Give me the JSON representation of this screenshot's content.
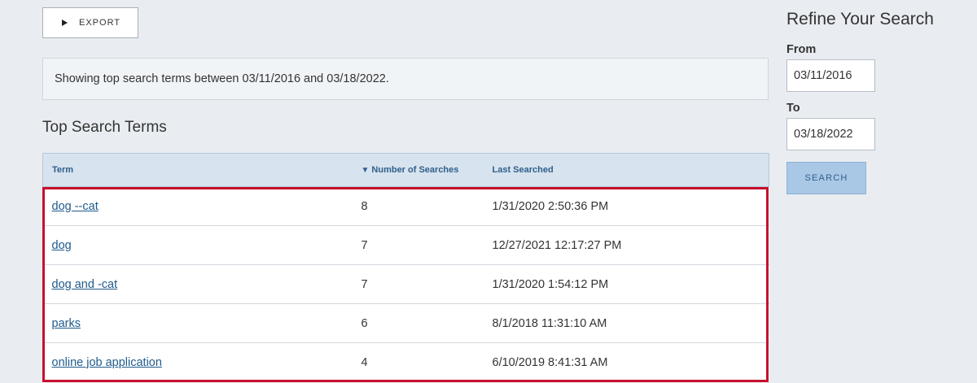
{
  "toolbar": {
    "export_label": "EXPORT"
  },
  "info": {
    "summary": "Showing top search terms between 03/11/2016 and 03/18/2022."
  },
  "results": {
    "title": "Top Search Terms",
    "columns": {
      "term": "Term",
      "count": "Number of Searches",
      "last": "Last Searched"
    },
    "sort_indicator": "▼",
    "rows": [
      {
        "term": "dog --cat",
        "count": "8",
        "last": "1/31/2020 2:50:36 PM"
      },
      {
        "term": "dog",
        "count": "7",
        "last": "12/27/2021 12:17:27 PM"
      },
      {
        "term": "dog and -cat",
        "count": "7",
        "last": "1/31/2020 1:54:12 PM"
      },
      {
        "term": "parks",
        "count": "6",
        "last": "8/1/2018 11:31:10 AM"
      },
      {
        "term": "online job application",
        "count": "4",
        "last": "6/10/2019 8:41:31 AM"
      }
    ]
  },
  "sidebar": {
    "title": "Refine Your Search",
    "from_label": "From",
    "from_value": "03/11/2016",
    "to_label": "To",
    "to_value": "03/18/2022",
    "search_label": "SEARCH"
  },
  "colors": {
    "highlight": "#c8102e",
    "link": "#1f5a8c",
    "header_bg": "#d7e3ef",
    "search_button": "#a8c8e6"
  }
}
